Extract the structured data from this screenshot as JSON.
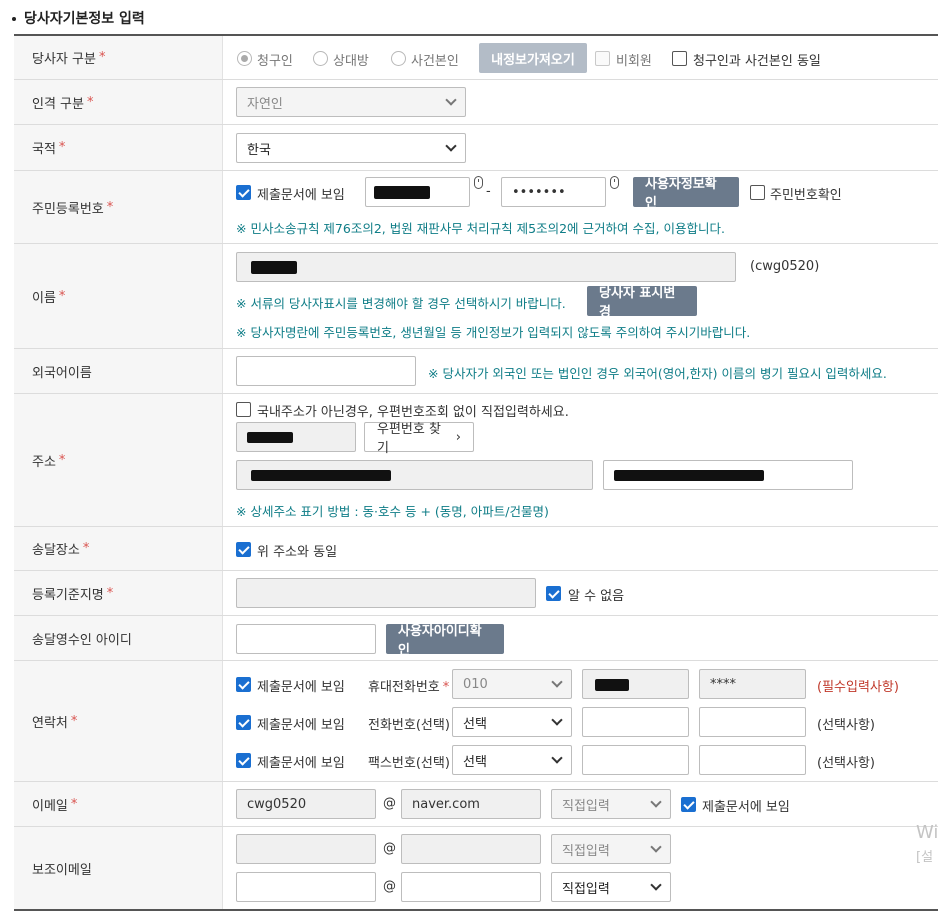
{
  "section": {
    "title": "당사자기본정보 입력"
  },
  "party_type": {
    "label": "당사자 구분",
    "options": [
      "청구인",
      "상대방",
      "사건본인"
    ],
    "selected": "청구인",
    "load_button": "내정보가져오기",
    "nonmember_label": "비회원",
    "same_label": "청구인과 사건본인 동일"
  },
  "person_type": {
    "label": "인격 구분",
    "value": "자연인"
  },
  "nationality": {
    "label": "국적",
    "value": "한국"
  },
  "rrn": {
    "label": "주민등록번호",
    "show_label": "제출문서에 보임",
    "back_value": "•••••••",
    "check_button": "사용자정보확인",
    "rrn_check_label": "주민번호확인",
    "note": "※ 민사소송규칙 제76조의2, 법원 재판사무 처리규칙 제5조의2에 근거하여 수집, 이용합니다."
  },
  "name": {
    "label": "이름",
    "user_id": "(cwg0520)",
    "note1": "※ 서류의 당사자표시를 변경해야 할 경우 선택하시기 바랍니다.",
    "change_button": "당사자 표시변경",
    "note2": "※ 당사자명란에 주민등록번호, 생년월일 등 개인정보가 입력되지 않도록 주의하여 주시기바랍니다."
  },
  "foreign_name": {
    "label": "외국어이름",
    "note": "※ 당사자가 외국인 또는 법인인 경우 외국어(영어,한자) 이름의 병기 필요시 입력하세요."
  },
  "address": {
    "label": "주소",
    "overseas_label": "국내주소가 아닌경우, 우편번호조회 없이 직접입력하세요.",
    "zip_button": "우편번호 찾기",
    "note": "※ 상세주소 표기 방법 : 동·호수 등 + (동명, 아파트/건물명)"
  },
  "delivery": {
    "label": "송달장소",
    "same_label": "위 주소와 동일"
  },
  "reg_place": {
    "label": "등록기준지명",
    "unknown_label": "알 수 없음"
  },
  "receiver": {
    "label": "송달영수인 아이디",
    "check_button": "사용자아이디확인"
  },
  "contact": {
    "label": "연락처",
    "rows": [
      {
        "show_label": "제출문서에 보임",
        "type_label": "휴대전화번호",
        "required": true,
        "select": "010",
        "third": "****",
        "status": "(필수입력사항)"
      },
      {
        "show_label": "제출문서에 보임",
        "type_label": "전화번호(선택)",
        "required": false,
        "select": "선택",
        "third": "",
        "status": "(선택사항)"
      },
      {
        "show_label": "제출문서에 보임",
        "type_label": "팩스번호(선택)",
        "required": false,
        "select": "선택",
        "third": "",
        "status": "(선택사항)"
      }
    ]
  },
  "email": {
    "label": "이메일",
    "local": "cwg0520",
    "at": "@",
    "domain": "naver.com",
    "select": "직접입력",
    "show_label": "제출문서에 보임"
  },
  "sub_email": {
    "label": "보조이메일",
    "at": "@",
    "select1": "직접입력",
    "select2": "직접입력"
  },
  "watermark": {
    "line1": "Wi",
    "line2": "[설"
  }
}
